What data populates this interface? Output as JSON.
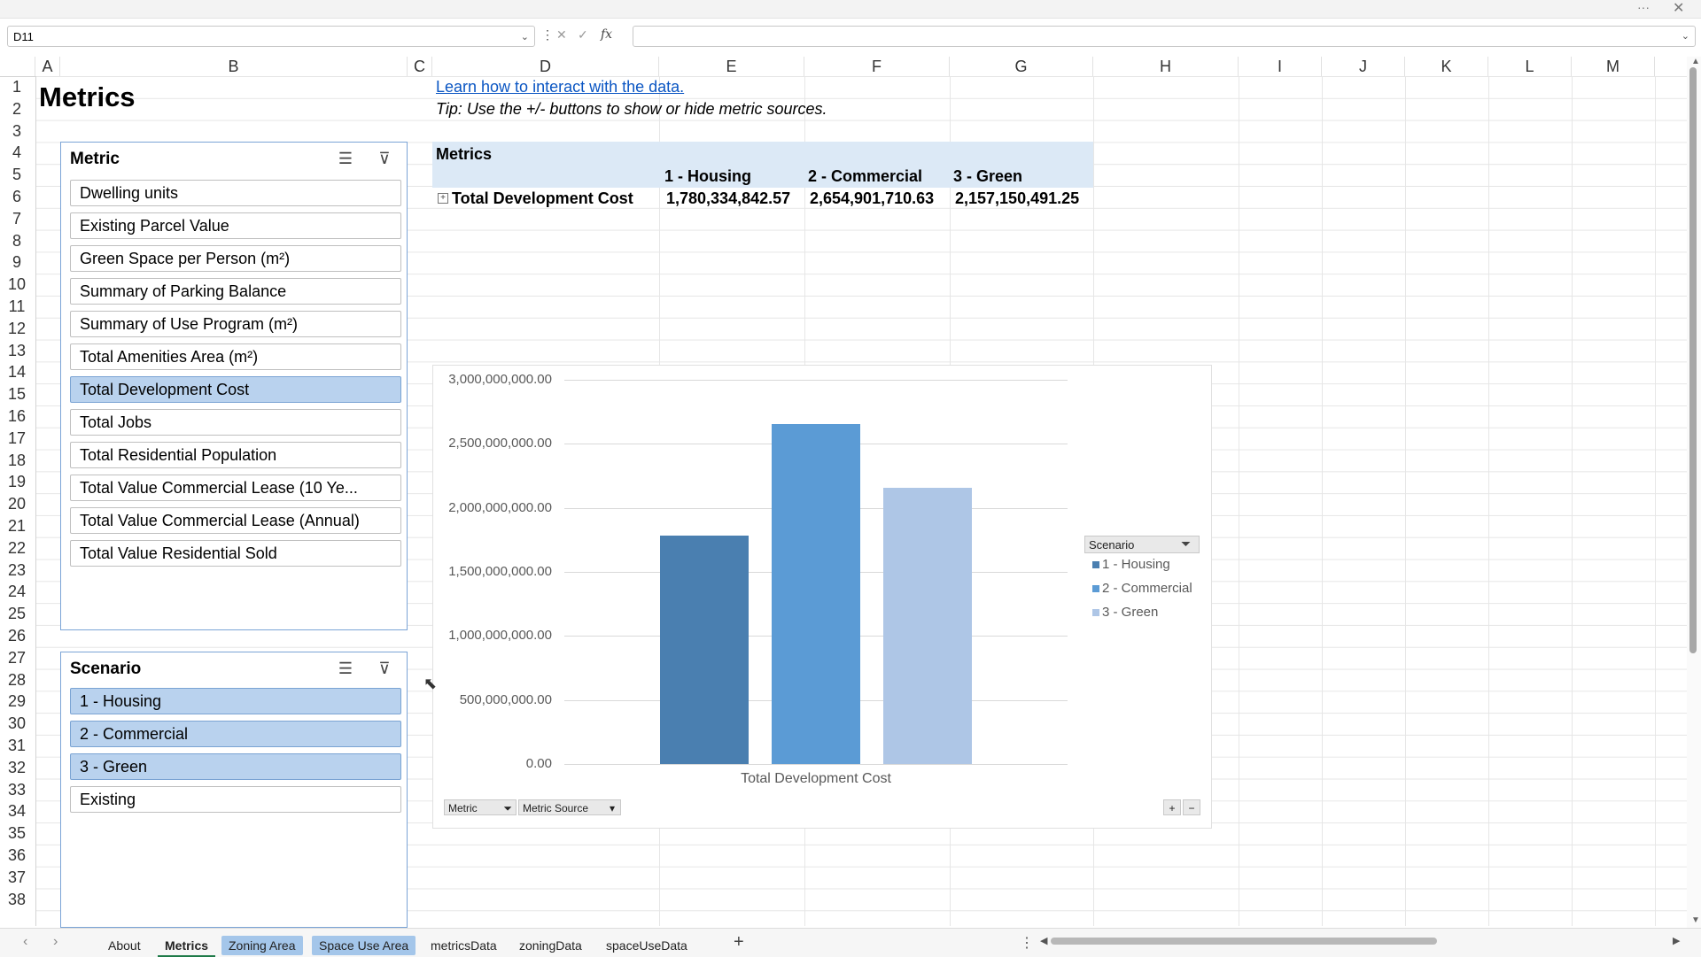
{
  "formula_bar": {
    "name_box": "D11",
    "fx": "fx"
  },
  "columns": [
    "A",
    "B",
    "C",
    "D",
    "E",
    "F",
    "G",
    "H",
    "I",
    "J",
    "K",
    "L",
    "M"
  ],
  "rows": [
    "1",
    "2",
    "3",
    "4",
    "5",
    "6",
    "7",
    "8",
    "9",
    "10",
    "11",
    "12",
    "13",
    "14",
    "15",
    "16",
    "17",
    "18",
    "19",
    "20",
    "21",
    "22",
    "23",
    "24",
    "25",
    "26",
    "27",
    "28",
    "29",
    "30",
    "31",
    "32",
    "33",
    "34",
    "35",
    "36",
    "37",
    "38"
  ],
  "sheet": {
    "title": "Metrics",
    "link": "Learn how to interact with the data.",
    "tip": "Tip: Use the +/- buttons to show or hide metric sources."
  },
  "metric_slicer": {
    "title": "Metric",
    "items": [
      {
        "label": "Dwelling units",
        "selected": false
      },
      {
        "label": "Existing Parcel Value",
        "selected": false
      },
      {
        "label": "Green Space per Person (m²)",
        "selected": false
      },
      {
        "label": "Summary of Parking Balance",
        "selected": false
      },
      {
        "label": "Summary of Use Program (m²)",
        "selected": false
      },
      {
        "label": "Total Amenities Area (m²)",
        "selected": false
      },
      {
        "label": "Total Development Cost",
        "selected": true
      },
      {
        "label": "Total Jobs",
        "selected": false
      },
      {
        "label": "Total Residential Population",
        "selected": false
      },
      {
        "label": "Total Value Commercial Lease (10 Ye...",
        "selected": false
      },
      {
        "label": "Total Value Commercial Lease (Annual)",
        "selected": false
      },
      {
        "label": "Total Value Residential Sold",
        "selected": false
      }
    ]
  },
  "scenario_slicer": {
    "title": "Scenario",
    "items": [
      {
        "label": "1 - Housing",
        "selected": true
      },
      {
        "label": "2 - Commercial",
        "selected": true
      },
      {
        "label": "3 - Green",
        "selected": true
      },
      {
        "label": "Existing",
        "selected": false
      }
    ]
  },
  "pivot": {
    "header": "Metrics",
    "columns": [
      "1 - Housing",
      "2 - Commercial",
      "3 - Green"
    ],
    "row_label": "Total Development Cost",
    "values": [
      "1,780,334,842.57",
      "2,654,901,710.63",
      "2,157,150,491.25"
    ]
  },
  "chart_data": {
    "type": "bar",
    "categories": [
      "Total Development Cost"
    ],
    "series": [
      {
        "name": "1 - Housing",
        "values": [
          1780334842.57
        ],
        "color": "#4a7fb0"
      },
      {
        "name": "2 - Commercial",
        "values": [
          2654901710.63
        ],
        "color": "#5b9bd5"
      },
      {
        "name": "3 - Green",
        "values": [
          2157150491.25
        ],
        "color": "#aec6e6"
      }
    ],
    "ylim": [
      0,
      3000000000
    ],
    "yticks": [
      "3,000,000,000.00",
      "2,500,000,000.00",
      "2,000,000,000.00",
      "1,500,000,000.00",
      "1,000,000,000.00",
      "500,000,000.00",
      "0.00"
    ],
    "xlabel": "Total Development Cost",
    "legend_title": "Scenario",
    "legend_position": "right",
    "grid": true,
    "field_buttons": [
      "Metric",
      "Metric Source"
    ],
    "zoom_buttons": [
      "+",
      "−"
    ]
  },
  "sheet_tabs": [
    {
      "label": "About",
      "colored": false,
      "active": false
    },
    {
      "label": "Metrics",
      "colored": false,
      "active": true
    },
    {
      "label": "Zoning Area",
      "colored": true,
      "active": false
    },
    {
      "label": "Space Use Area",
      "colored": true,
      "active": false
    },
    {
      "label": "metricsData",
      "colored": false,
      "active": false
    },
    {
      "label": "zoningData",
      "colored": false,
      "active": false
    },
    {
      "label": "spaceUseData",
      "colored": false,
      "active": false
    }
  ],
  "add_sheet": "+"
}
